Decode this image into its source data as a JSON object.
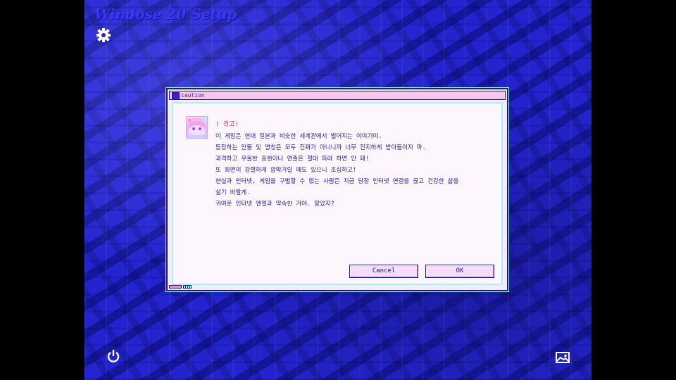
{
  "app": {
    "title": "Windose 20 Setup"
  },
  "icons": {
    "settings": "gear-icon",
    "power": "power-icon",
    "wallpaper": "image-icon"
  },
  "dialog": {
    "title": "caution",
    "heading": "! 경고!",
    "lines": [
      "이 게임은 현대 일본과 비슷한 세계관에서 벌어지는 이야기야.",
      "등장하는 인물 및 명칭은 모두 진짜가 아니니까 너무 진지하게 받아들이지 마.",
      "과격하고 우울한 표현이나 연출은 절대 따라 하면 안 돼!",
      "또 화면이 강렬하게 깜박거릴 때도 있으니 조심하고!",
      "현실과 인터넷, 게임을 구별할 수 없는 사람은 지금 당장 인터넷 연결을 끊고 건강한 삶을",
      "살기 바랄게.",
      "귀여운 인터넷 엔젤과 약속한 거야. 알았지?"
    ],
    "cancel_label": "Cancel",
    "ok_label": "OK"
  },
  "colors": {
    "background": "#2424cf",
    "dialog_bg": "#fbe8fb",
    "accent_cyan": "#9ff6ef",
    "text_blue": "#2020a8",
    "warning_red": "#e0306a"
  }
}
